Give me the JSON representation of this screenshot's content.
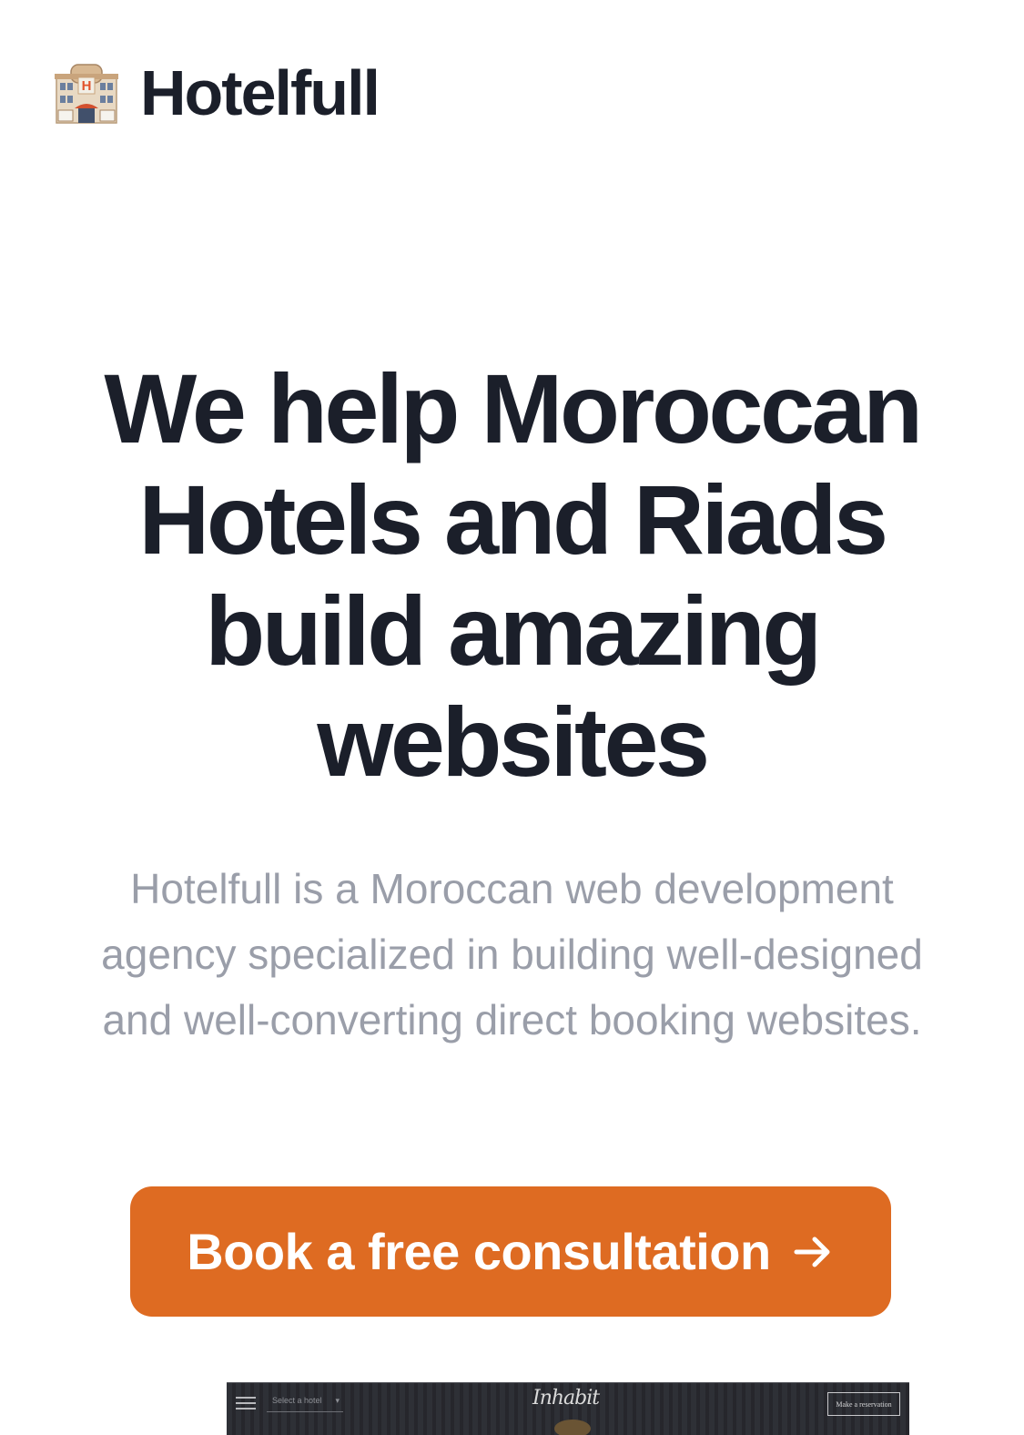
{
  "header": {
    "logo_icon": "hotel-building-emoji-icon",
    "brand": "Hotelfull"
  },
  "hero": {
    "title": "We help Moroccan Hotels and Riads build amazing websites",
    "subtitle": "Hotelfull is a Moroccan web development agency specialized in building well-designed and well-converting direct booking websites."
  },
  "cta": {
    "label": "Book a free consultation",
    "icon": "arrow-right-icon",
    "color": "#de6b22"
  },
  "preview": {
    "site_logo": "Inhabit",
    "select_placeholder": "Select a hotel",
    "reserve_label": "Make a reservation",
    "menu_icon": "hamburger-menu-icon"
  },
  "colors": {
    "heading": "#1b1f2a",
    "subtext": "#9a9ea9",
    "accent": "#de6b22"
  }
}
